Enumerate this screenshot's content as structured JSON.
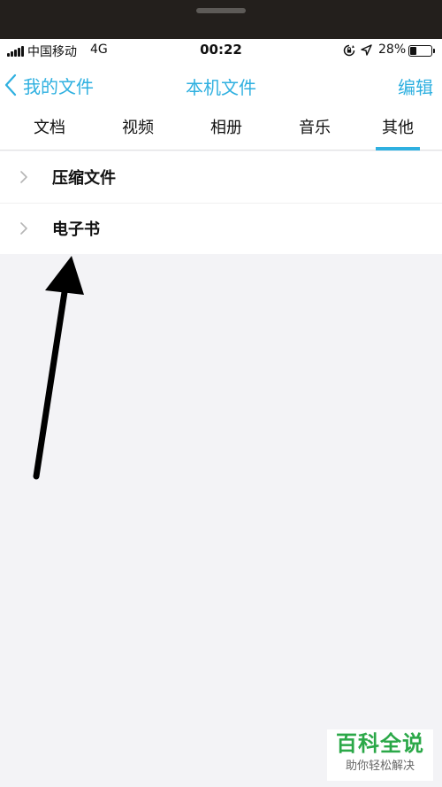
{
  "status_bar": {
    "carrier": "中国移动",
    "network": "4G",
    "time": "00:22",
    "battery": "28%",
    "battery_level": 0.28
  },
  "nav": {
    "back_label": "我的文件",
    "title": "本机文件",
    "edit_label": "编辑"
  },
  "tabs": [
    {
      "label": "文档"
    },
    {
      "label": "视频"
    },
    {
      "label": "相册"
    },
    {
      "label": "音乐"
    },
    {
      "label": "其他",
      "active": true
    }
  ],
  "list": [
    {
      "label": "压缩文件"
    },
    {
      "label": "电子书"
    }
  ],
  "watermark": {
    "title": "百科全说",
    "subtitle": "助你轻松解决"
  },
  "colors": {
    "accent": "#2fb0e0",
    "background": "#f3f3f6",
    "watermark_green": "#2ba848"
  }
}
